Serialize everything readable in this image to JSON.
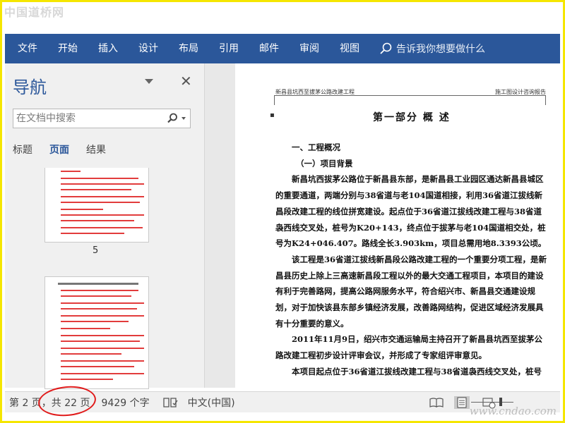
{
  "watermark_top": "中国道桥网",
  "watermark_bottom": "www.cndao.com",
  "ribbon": {
    "tabs": [
      "文件",
      "开始",
      "插入",
      "设计",
      "布局",
      "引用",
      "邮件",
      "审阅",
      "视图"
    ],
    "tell_me": "告诉我你想要做什么"
  },
  "nav": {
    "title": "导航",
    "search_placeholder": "在文档中搜索",
    "tabs": [
      "标题",
      "页面",
      "结果"
    ],
    "active_tab": "页面",
    "thumbnails": [
      {
        "page": "5"
      },
      {
        "page": ""
      }
    ]
  },
  "document": {
    "header_left": "新昌县坑西至拔茅公路改建工程",
    "header_right": "施工图设计咨询报告",
    "title": "第一部分   概   述",
    "paragraphs": [
      {
        "style": "h1",
        "text": "一、工程概况"
      },
      {
        "style": "h2",
        "text": "（一）项目背景"
      },
      {
        "style": "indent",
        "text": "新昌坑西拔茅公路位于新昌县东部，是新昌县工业园区通达新昌县城区的重要通道，两端分别与38省道与老104国道相接，利用36省道江拔线新昌段改建工程的线位拼宽建设。起点位于36省道江拔线改建工程与38省道袅西线交叉处，桩号为K20+143，终点位于拔茅与老104国道相交处，桩号为K24+046.407。路线全长3.903km，项目总需用地8.3393公顷。"
      },
      {
        "style": "indent",
        "text": "该工程是36省道江拔线新昌段公路改建工程的一个重要分项工程，是新昌县历史上除上三高速新昌段工程以外的最大交通工程项目，本项目的建设有利于完善路网，提高公路网服务水平，符合绍兴市、新昌县交通建设规划，对于加快该县东部乡镇经济发展，改善路网结构，促进区域经济发展具有十分重要的意义。"
      },
      {
        "style": "indent",
        "text": "2011年11月9日，绍兴市交通运输局主持召开了新昌县坑西至拔茅公路改建工程初步设计评审会议，并形成了专家组评审意见。"
      },
      {
        "style": "indent",
        "text": "本项目起点位于36省道江拔线改建工程与38省道袅西线交叉处，桩号"
      }
    ]
  },
  "status": {
    "page": "第 2 页，共 22 页",
    "words": "9429 个字",
    "language": "中文(中国)"
  },
  "colors": {
    "ribbon": "#2b579a",
    "accent": "#2b579a",
    "annotation": "#e01b1b",
    "frame": "#f5e600"
  }
}
